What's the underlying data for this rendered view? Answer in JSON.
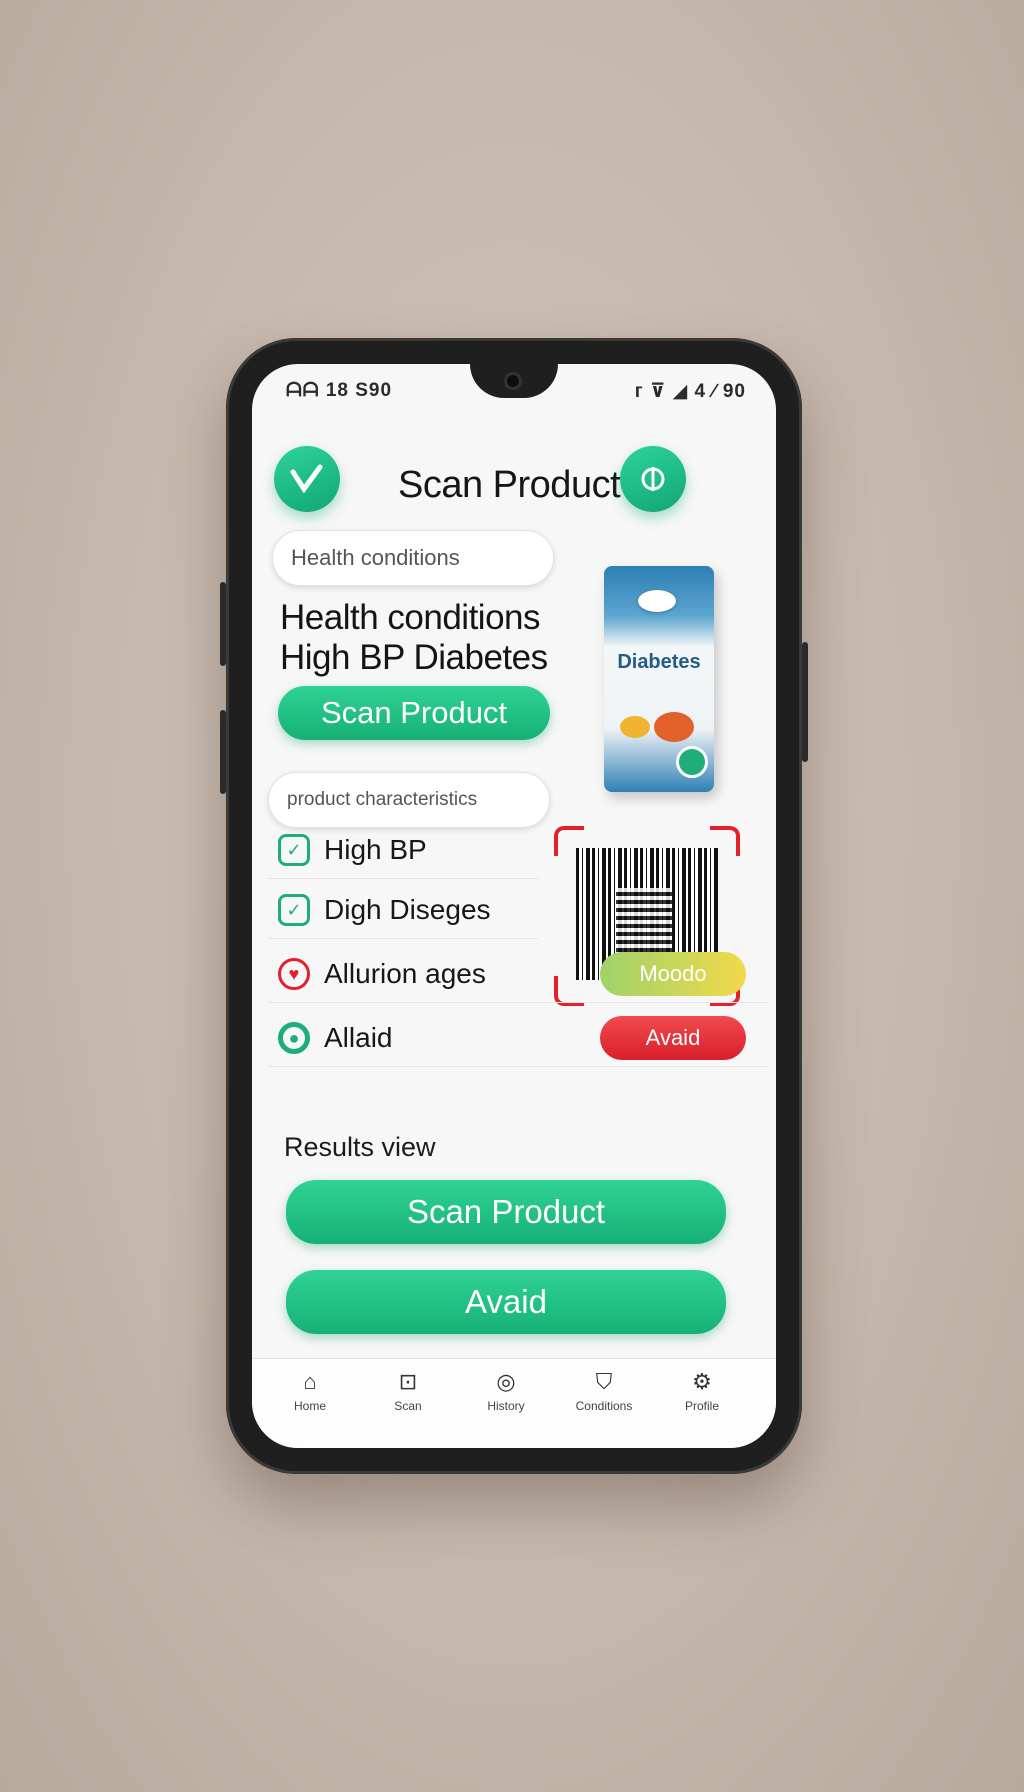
{
  "status_bar": {
    "left": "ᗩᗩ 18 S90",
    "right": "ᴦ ⊽ ◢ 4 ∕ 90"
  },
  "header": {
    "title": "Scan Product",
    "left_icon": "health-logo-icon",
    "right_icon": "profile-icon"
  },
  "health_input": {
    "value": "Health conditions"
  },
  "health_text": {
    "line1": "Health conditions",
    "line2": "High BP Diabetes"
  },
  "scan_button_small": {
    "label": "Scan Product"
  },
  "product": {
    "package_label": "Diabetes"
  },
  "product_input": {
    "value": "product characteristics"
  },
  "conditions": [
    {
      "label": "High BP",
      "icon": "check-shield-icon",
      "color": "#1fae7a",
      "badge": ""
    },
    {
      "label": "Digh Diseges",
      "icon": "check-shield-icon",
      "color": "#1fae7a",
      "badge": ""
    },
    {
      "label": "Allurion ages",
      "icon": "heart-icon",
      "color": "#e3202b",
      "badge": "Moodo"
    },
    {
      "label": "Allaid",
      "icon": "circle-check-icon",
      "color": "#1fae7a",
      "badge": "Avaid"
    }
  ],
  "results_label": "Results view",
  "primary_button": {
    "label": "Scan Product"
  },
  "secondary_button": {
    "label": "Avaid"
  },
  "bottom_nav": [
    {
      "icon": "home-icon",
      "label": "Home"
    },
    {
      "icon": "scan-icon",
      "label": "Scan"
    },
    {
      "icon": "history-icon",
      "label": "History"
    },
    {
      "icon": "shield-icon",
      "label": "Conditions"
    },
    {
      "icon": "settings-icon",
      "label": "Profile"
    }
  ],
  "colors": {
    "accent_green": "#17b076",
    "badge_yellow": "#d8c94a",
    "badge_red": "#e3202b"
  }
}
